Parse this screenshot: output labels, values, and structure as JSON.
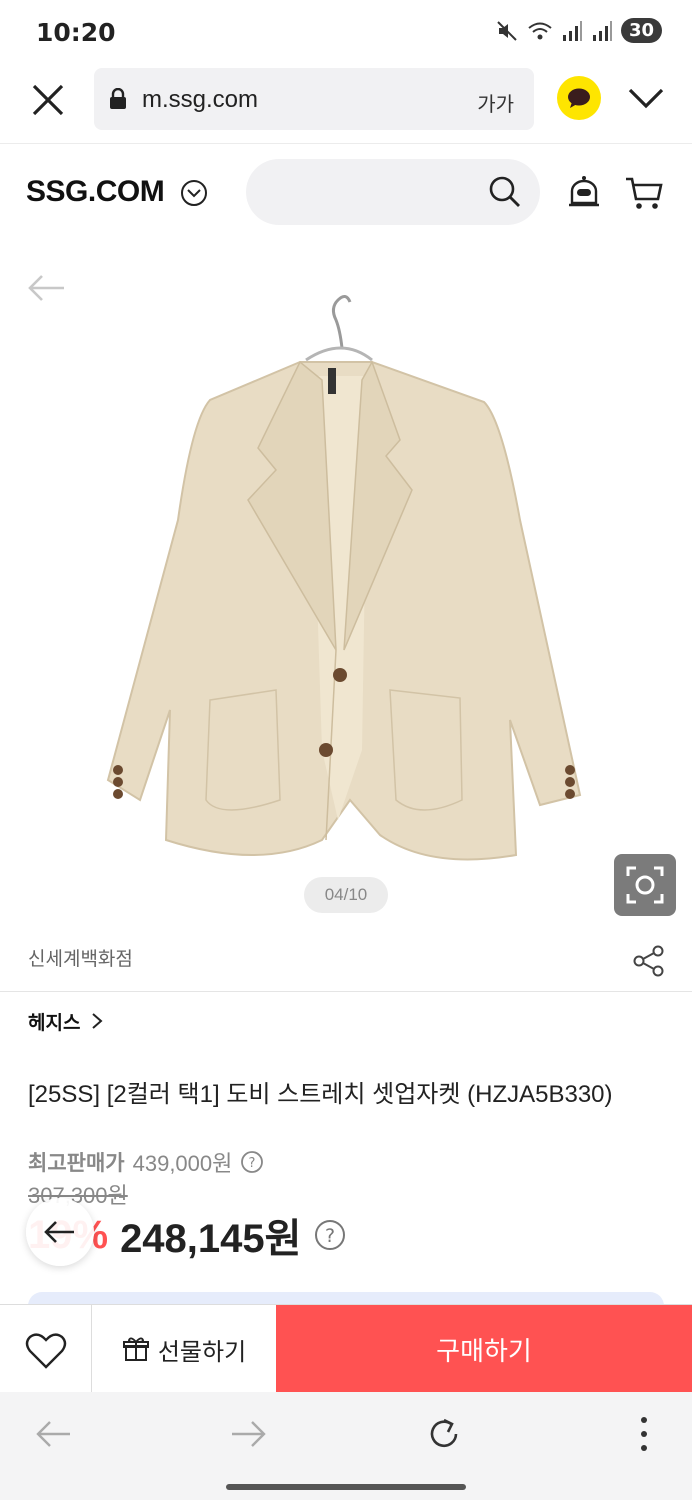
{
  "status_bar": {
    "time": "10:20",
    "battery": "30",
    "icons": [
      "mute-icon",
      "wifi-icon",
      "signal-icon",
      "signal-icon"
    ]
  },
  "browser": {
    "url": "m.ssg.com",
    "font_size_label": "가가"
  },
  "site": {
    "logo": "SSG.COM",
    "search_placeholder": ""
  },
  "gallery": {
    "page_indicator": "04/10"
  },
  "product": {
    "seller": "신세계백화점",
    "brand": "헤지스",
    "title": "[25SS] [2컬러 택1] 도비 스트레치 셋업자켓 (HZJA5B330)",
    "best_price_label": "최고판매가",
    "best_price": "439,000원",
    "original_price": "307,300원",
    "discount": "19%",
    "sale_price": "248,145원"
  },
  "actions": {
    "gift_label": "선물하기",
    "buy_label": "구매하기"
  },
  "colors": {
    "buy_button": "#ff5252",
    "discount": "#ff5252",
    "kakao": "#fee500",
    "jacket": "#e8dcc4"
  }
}
